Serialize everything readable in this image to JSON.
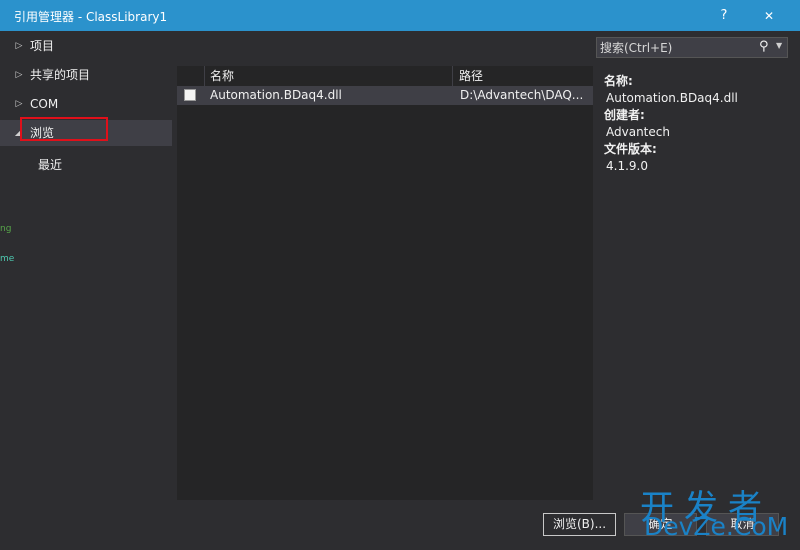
{
  "window": {
    "title": "引用管理器 - ClassLibrary1",
    "help": "?",
    "close": "✕"
  },
  "nav": [
    {
      "label": "项目",
      "arrow": "▷"
    },
    {
      "label": "共享的项目",
      "arrow": "▷"
    },
    {
      "label": "COM",
      "arrow": "▷"
    },
    {
      "label": "浏览",
      "arrow": "◢"
    },
    {
      "label": "最近",
      "arrow": ""
    }
  ],
  "edge_glyphs": [
    "ng",
    "me"
  ],
  "list": {
    "columns": [
      "名称",
      "路径"
    ],
    "rows": [
      {
        "name": "Automation.BDaq4.dll",
        "path": "D:\\Advantech\\DAQ..."
      }
    ]
  },
  "search": {
    "placeholder": "搜索(Ctrl+E)",
    "icon": "search-icon"
  },
  "details": [
    {
      "key": "名称:",
      "value": "Automation.BDaq4.dll"
    },
    {
      "key": "创建者:",
      "value": "Advantech"
    },
    {
      "key": "文件版本:",
      "value": "4.1.9.0"
    }
  ],
  "buttons": {
    "browse": "浏览(B)...",
    "ok": "确定",
    "cancel": "取消"
  },
  "watermark": {
    "line1": "开发者",
    "line2": "DevZe.CoM"
  },
  "colors": {
    "titlebar": "#2b92cc",
    "background": "#2d2d30",
    "panel": "#252526",
    "highlight": "#e0101a"
  }
}
